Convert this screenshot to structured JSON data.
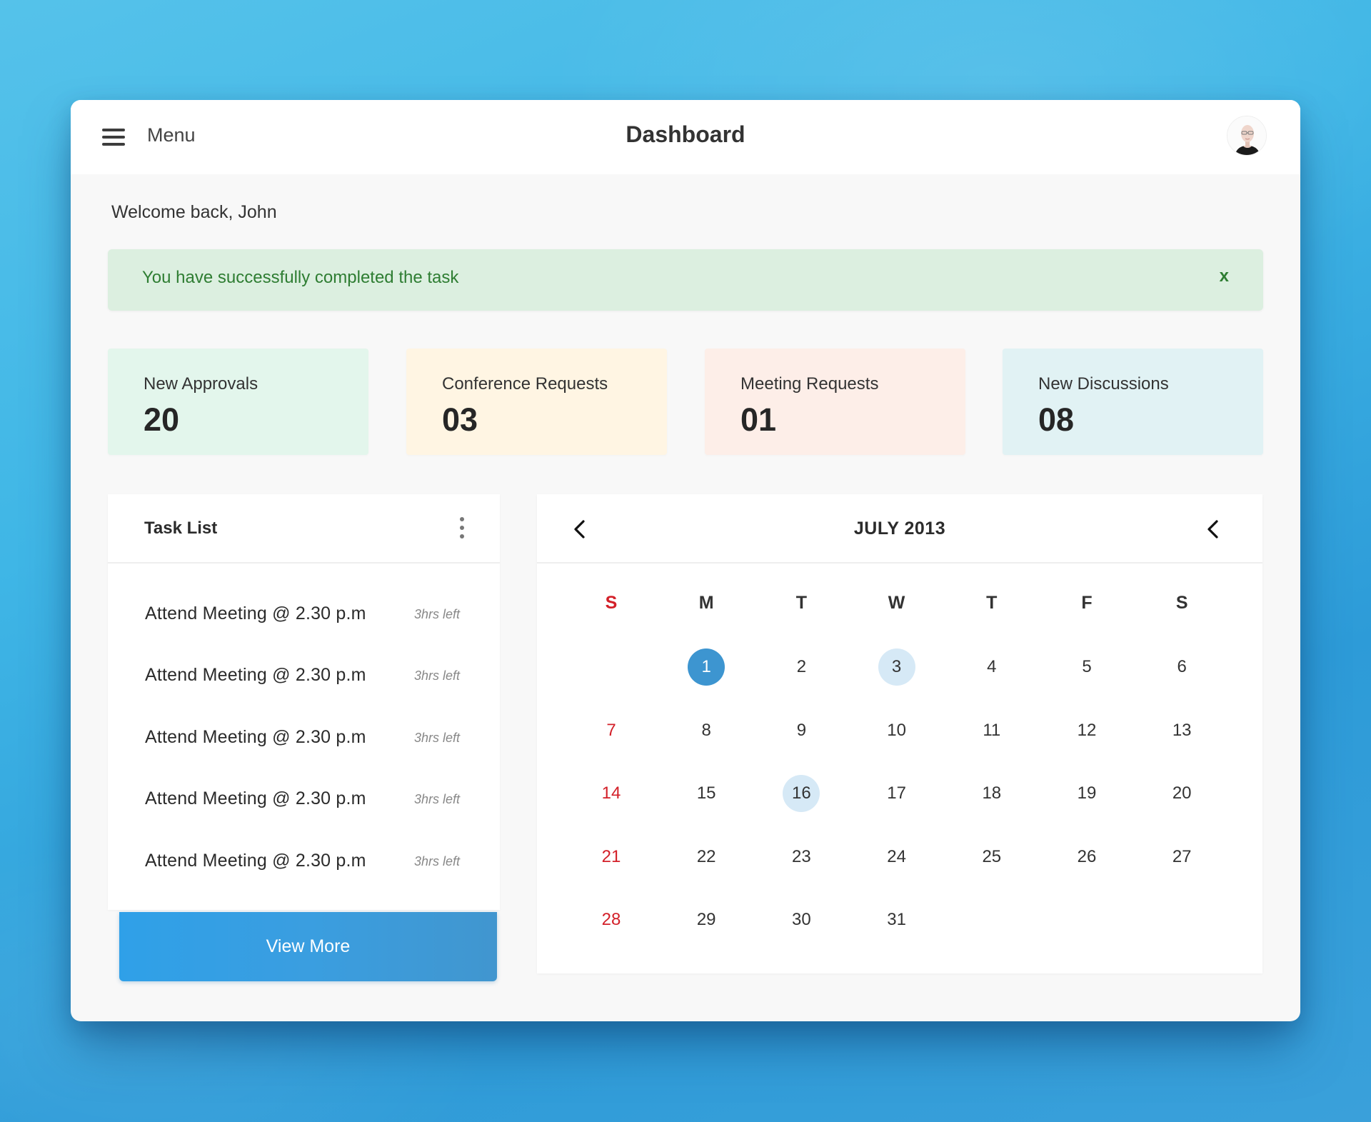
{
  "header": {
    "menu_label": "Menu",
    "title": "Dashboard",
    "avatar_alt": "User avatar"
  },
  "welcome": "Welcome back, John",
  "alert": {
    "message": "You have successfully completed the task",
    "close_label": "x",
    "text_color": "#2e7d32",
    "bg_color": "#dcefe0"
  },
  "stats": [
    {
      "label": "New Approvals",
      "value": "20",
      "bg": "#e3f6ec"
    },
    {
      "label": "Conference Requests",
      "value": "03",
      "bg": "#fff5e3"
    },
    {
      "label": "Meeting Requests",
      "value": "01",
      "bg": "#fdeee8"
    },
    {
      "label": "New Discussions",
      "value": "08",
      "bg": "#e1f2f4"
    }
  ],
  "tasks": {
    "title": "Task List",
    "items": [
      {
        "text": "Attend Meeting @ 2.30 p.m",
        "time": "3hrs left"
      },
      {
        "text": "Attend Meeting @ 2.30 p.m",
        "time": "3hrs left"
      },
      {
        "text": "Attend Meeting @ 2.30 p.m",
        "time": "3hrs left"
      },
      {
        "text": "Attend Meeting @ 2.30 p.m",
        "time": "3hrs left"
      },
      {
        "text": "Attend Meeting @ 2.30 p.m",
        "time": "3hrs left"
      }
    ],
    "view_more_label": "View More"
  },
  "calendar": {
    "title": "JULY 2013",
    "weekdays": [
      "S",
      "M",
      "T",
      "W",
      "T",
      "F",
      "S"
    ],
    "first_weekday_index": 1,
    "days_in_month": 31,
    "selected_day": 1,
    "marked_days": [
      3,
      16
    ],
    "accent_color": "#3d95d0",
    "weekend_color": "#d32029"
  }
}
